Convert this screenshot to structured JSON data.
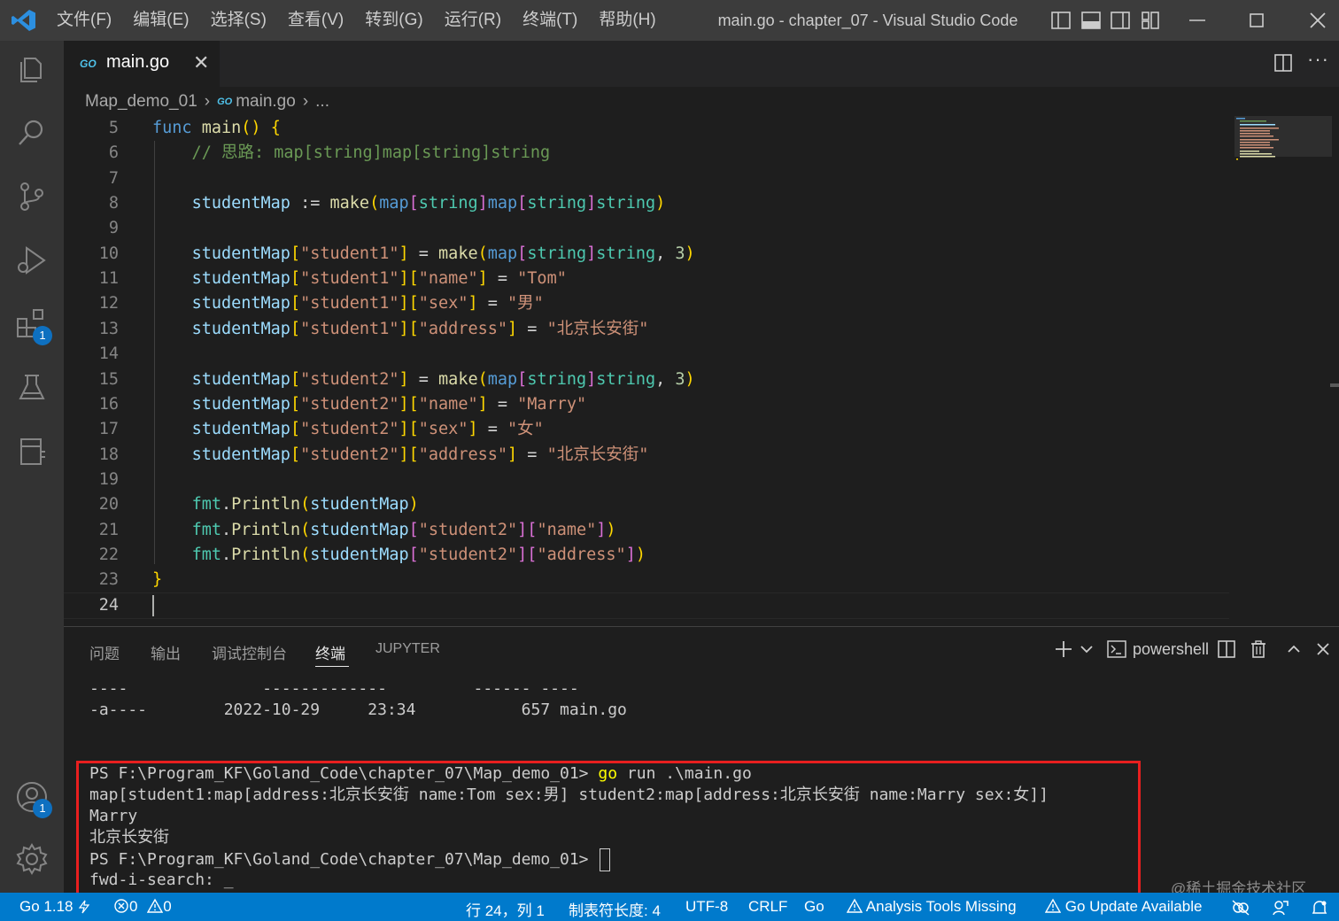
{
  "menu": [
    "文件(F)",
    "编辑(E)",
    "选择(S)",
    "查看(V)",
    "转到(G)",
    "运行(R)",
    "终端(T)",
    "帮助(H)"
  ],
  "window_title": "main.go - chapter_07 - Visual Studio Code",
  "activity": {
    "extensions_badge": "1",
    "accounts_badge": "1"
  },
  "tab": {
    "icon_text": "GO",
    "label": "main.go",
    "close": "✕"
  },
  "breadcrumb": {
    "folder": "Map_demo_01",
    "file": "main.go",
    "more": "..."
  },
  "editor": {
    "line_numbers": [
      "5",
      "6",
      "7",
      "8",
      "9",
      "10",
      "11",
      "12",
      "13",
      "14",
      "15",
      "16",
      "17",
      "18",
      "19",
      "20",
      "21",
      "22",
      "23",
      "24"
    ],
    "lines": [
      "func main() {",
      "    // 思路: map[string]map[string]string",
      "",
      "    studentMap := make(map[string]map[string]string)",
      "",
      "    studentMap[\"student1\"] = make(map[string]string, 3)",
      "    studentMap[\"student1\"][\"name\"] = \"Tom\"",
      "    studentMap[\"student1\"][\"sex\"] = \"男\"",
      "    studentMap[\"student1\"][\"address\"] = \"北京长安街\"",
      "",
      "    studentMap[\"student2\"] = make(map[string]string, 3)",
      "    studentMap[\"student2\"][\"name\"] = \"Marry\"",
      "    studentMap[\"student2\"][\"sex\"] = \"女\"",
      "    studentMap[\"student2\"][\"address\"] = \"北京长安街\"",
      "",
      "    fmt.Println(studentMap)",
      "    fmt.Println(studentMap[\"student2\"][\"name\"])",
      "    fmt.Println(studentMap[\"student2\"][\"address\"])",
      "}",
      ""
    ]
  },
  "panel": {
    "tabs": [
      "问题",
      "输出",
      "调试控制台",
      "终端",
      "JUPYTER"
    ],
    "active_tab": "终端",
    "shell": "powershell",
    "terminal_lines": [
      "----              -------------         ------ ----",
      "-a----        2022-10-29     23:34           657 main.go",
      "",
      "",
      "PS F:\\Program_KF\\Goland_Code\\chapter_07\\Map_demo_01> go run .\\main.go",
      "map[student1:map[address:北京长安街 name:Tom sex:男] student2:map[address:北京长安街 name:Marry sex:女]]",
      "Marry",
      "北京长安街",
      "PS F:\\Program_KF\\Goland_Code\\chapter_07\\Map_demo_01> ",
      "fwd-i-search: _"
    ],
    "prompt": "PS F:\\Program_KF\\Goland_Code\\chapter_07\\Map_demo_01>",
    "cmd_keyword": "go",
    "cmd_rest": " run .\\main.go"
  },
  "status": {
    "go_version": "Go 1.18",
    "errors": "0",
    "warnings": "0",
    "position": "行 24，列 1",
    "tab_size": "制表符长度: 4",
    "encoding": "UTF-8",
    "eol": "CRLF",
    "language": "Go",
    "analysis": "Analysis Tools Missing",
    "go_update": "Go Update Available"
  },
  "watermark": "@稀土掘金技术社区",
  "colors": {
    "accent": "#007acc",
    "highlight_box": "#e81f1f",
    "badge": "#0e70c0"
  }
}
